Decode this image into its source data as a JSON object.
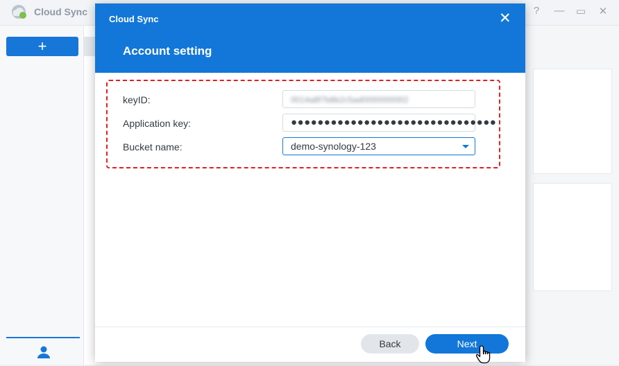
{
  "app": {
    "title": "Cloud Sync",
    "add_label": "+",
    "help_label": "?",
    "minimize_label": "—",
    "maximize_label": "▭",
    "close_label": "✕"
  },
  "dialog": {
    "window_title": "Cloud Sync",
    "close_label": "✕",
    "heading": "Account setting",
    "fields": {
      "key_id": {
        "label": "keyID:",
        "value": "0014a8f7b8b2c5ad0000000002"
      },
      "application_key": {
        "label": "Application key:",
        "value": "●●●●●●●●●●●●●●●●●●●●●●●●●●●●●●●"
      },
      "bucket_name": {
        "label": "Bucket name:",
        "value": "demo-synology-123"
      }
    },
    "buttons": {
      "back": "Back",
      "next": "Next"
    }
  },
  "colors": {
    "accent": "#1277d8",
    "highlight": "#e01f1f"
  },
  "icons": [
    "cloud-sync-logo-icon",
    "user-icon",
    "close-icon",
    "dropdown-caret-icon",
    "hand-cursor-icon"
  ]
}
